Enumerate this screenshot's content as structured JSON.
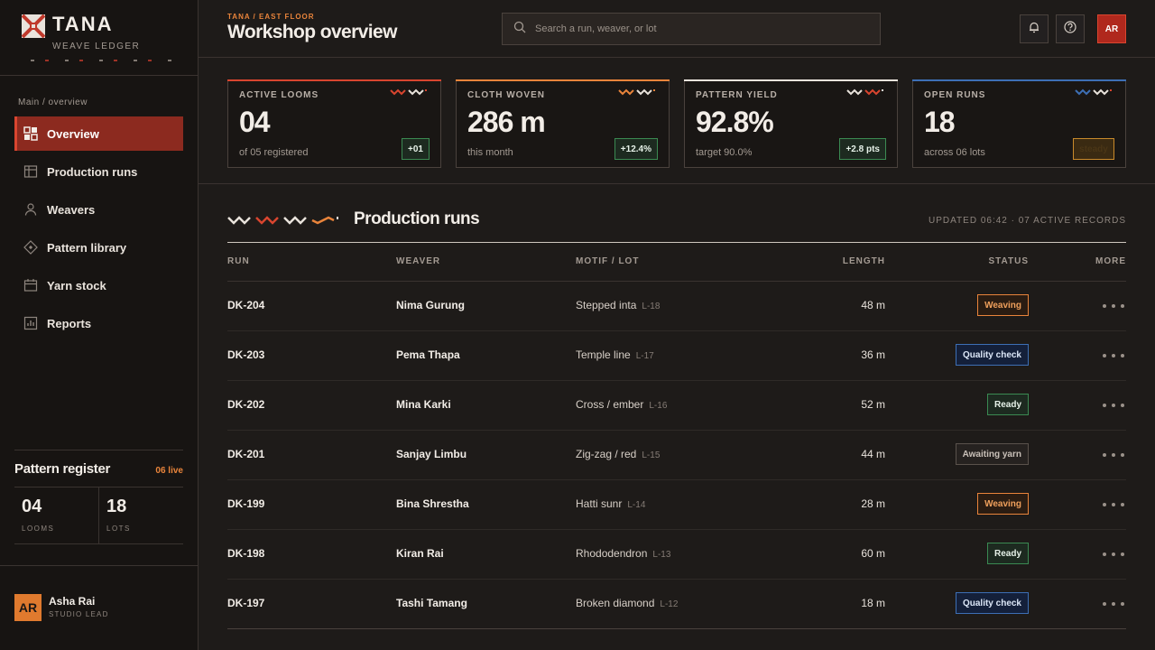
{
  "brand": {
    "name": "TANA",
    "subtitle": "WEAVE LEDGER"
  },
  "nav_caption": "Main / overview",
  "nav": [
    {
      "label": "Overview",
      "icon": "grid-icon",
      "active": true
    },
    {
      "label": "Production runs",
      "icon": "table-icon",
      "active": false
    },
    {
      "label": "Weavers",
      "icon": "person-icon",
      "active": false
    },
    {
      "label": "Pattern library",
      "icon": "diamond-icon",
      "active": false
    },
    {
      "label": "Yarn stock",
      "icon": "calendar-icon",
      "active": false
    },
    {
      "label": "Reports",
      "icon": "bar-chart-icon",
      "active": false
    }
  ],
  "register": {
    "title": "Pattern register",
    "live": "06 live",
    "looms_value": "04",
    "looms_label": "LOOMS",
    "lots_value": "18",
    "lots_label": "LOTS"
  },
  "user": {
    "initials": "AR",
    "name": "Asha Rai",
    "role": "STUDIO LEAD"
  },
  "header": {
    "crumb": "TANA / EAST FLOOR",
    "title": "Workshop overview",
    "search_placeholder": "Search a run, weaver, or lot",
    "avatar": "AR"
  },
  "cards": [
    {
      "label": "ACTIVE LOOMS",
      "value": "04",
      "sub": "of 05 registered",
      "badge": "+01",
      "accent": "#d9452f"
    },
    {
      "label": "CLOTH WOVEN",
      "value": "286 m",
      "sub": "this month",
      "badge": "+12.4%",
      "accent": "#e9843b"
    },
    {
      "label": "PATTERN YIELD",
      "value": "92.8%",
      "sub": "target 90.0%",
      "badge": "+2.8 pts",
      "accent": "#e9e3dc"
    },
    {
      "label": "OPEN RUNS",
      "value": "18",
      "sub": "across 06 lots",
      "badge": "steady",
      "accent": "#3d6fb5"
    }
  ],
  "section": {
    "title": "Production runs",
    "updated": "UPDATED 06:42 · 07 ACTIVE RECORDS"
  },
  "columns": {
    "run": "RUN",
    "weaver": "WEAVER",
    "motif": "MOTIF / LOT",
    "length": "LENGTH",
    "status": "STATUS",
    "more": "MORE"
  },
  "rows": [
    {
      "run": "DK-204",
      "weaver": "Nima Gurung",
      "motif": "Stepped inta",
      "lot": "L-18",
      "length": "48 m",
      "status": "Weaving",
      "status_kind": "weaving"
    },
    {
      "run": "DK-203",
      "weaver": "Pema Thapa",
      "motif": "Temple line",
      "lot": "L-17",
      "length": "36 m",
      "status": "Quality check",
      "status_kind": "quality"
    },
    {
      "run": "DK-202",
      "weaver": "Mina Karki",
      "motif": "Cross / ember",
      "lot": "L-16",
      "length": "52 m",
      "status": "Ready",
      "status_kind": "ready"
    },
    {
      "run": "DK-201",
      "weaver": "Sanjay Limbu",
      "motif": "Zig-zag / red",
      "lot": "L-15",
      "length": "44 m",
      "status": "Awaiting yarn",
      "status_kind": "await"
    },
    {
      "run": "DK-199",
      "weaver": "Bina Shrestha",
      "motif": "Hatti sunr",
      "lot": "L-14",
      "length": "28 m",
      "status": "Weaving",
      "status_kind": "weaving"
    },
    {
      "run": "DK-198",
      "weaver": "Kiran Rai",
      "motif": "Rhododendron",
      "lot": "L-13",
      "length": "60 m",
      "status": "Ready",
      "status_kind": "ready"
    },
    {
      "run": "DK-197",
      "weaver": "Tashi Tamang",
      "motif": "Broken diamond",
      "lot": "L-12",
      "length": "18 m",
      "status": "Quality check",
      "status_kind": "quality"
    }
  ]
}
